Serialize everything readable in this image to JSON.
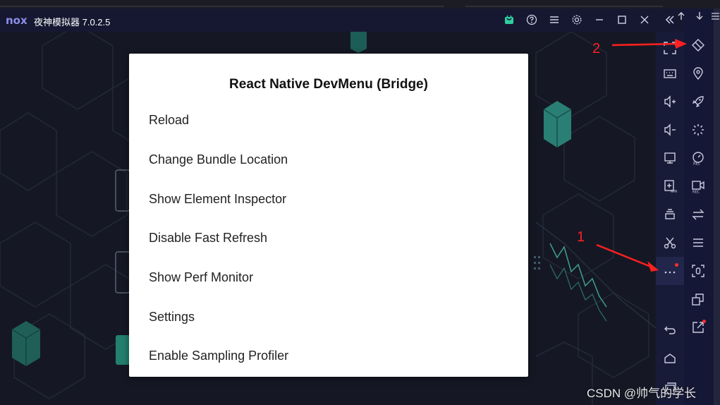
{
  "window": {
    "logo": "nox",
    "title": "夜神模拟器 7.0.2.5"
  },
  "titlebar_icons": [
    "shop-icon",
    "help-icon",
    "menu-icon",
    "settings-icon",
    "minimize-icon",
    "maximize-icon",
    "close-icon",
    "collapse-icon"
  ],
  "dialog": {
    "title": "React Native DevMenu (Bridge)",
    "items": [
      "Reload",
      "Change Bundle Location",
      "Show Element Inspector",
      "Disable Fast Refresh",
      "Show Perf Monitor",
      "Settings",
      "Enable Sampling Profiler"
    ]
  },
  "sidebar_left_icons": [
    "fullscreen-icon",
    "keyboard-icon",
    "volume-up-icon",
    "volume-down-icon",
    "screen-icon",
    "apk-install-icon",
    "multi-instance-icon",
    "scissors-icon",
    "more-icon",
    "back-icon",
    "home-icon",
    "recent-icon"
  ],
  "sidebar_right_icons": [
    "shake-icon",
    "location-icon",
    "rocket-icon",
    "loading-icon",
    "rec-speed-icon",
    "rec-video-icon",
    "swap-icon",
    "list-menu-icon",
    "screenshot-icon",
    "multi-window-icon",
    "export-icon"
  ],
  "annotations": {
    "label_1": "1",
    "label_2": "2"
  },
  "watermark": "CSDN @帅气的学长",
  "colors": {
    "dialog_bg": "#ffffff",
    "titlebar_bg": "#161832",
    "sidebar_bg": "#181b37",
    "annotation": "#ff2020",
    "accent_teal": "#2bb59a"
  }
}
